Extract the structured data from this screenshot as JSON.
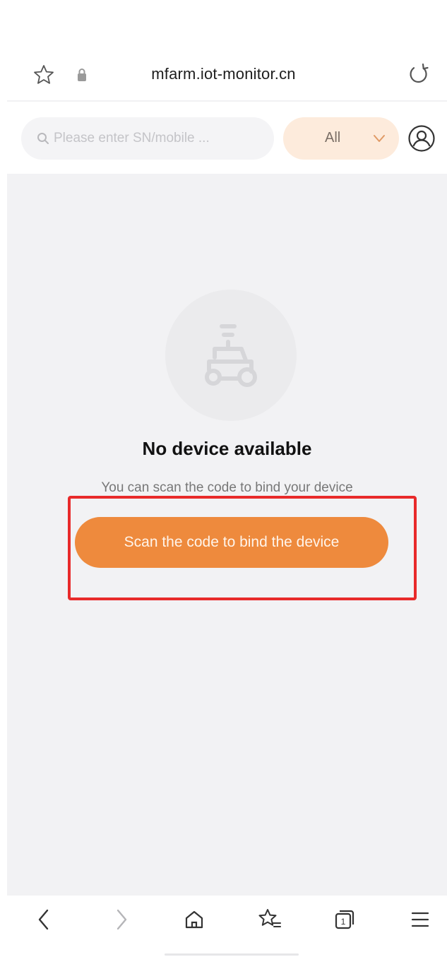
{
  "browser": {
    "url": "mfarm.iot-monitor.cn"
  },
  "search": {
    "placeholder": "Please enter SN/mobile ...",
    "value": ""
  },
  "filter": {
    "selected": "All"
  },
  "empty_state": {
    "title": "No device available",
    "subtitle": "You can scan the code to bind your device",
    "button_label": "Scan the code to bind the device"
  },
  "colors": {
    "accent": "#ee8a3d",
    "filter_bg": "#fdebdc",
    "highlight": "#e82a2a",
    "content_bg": "#f2f2f4"
  },
  "icons": {
    "bookmark": "star-icon",
    "secure": "lock-icon",
    "reload": "reload-icon",
    "search": "search-icon",
    "dropdown": "chevron-down-icon",
    "profile": "user-icon",
    "empty": "tractor-icon",
    "nav": [
      "back-icon",
      "forward-icon",
      "home-icon",
      "bookmarks-icon",
      "tabs-icon",
      "menu-icon"
    ]
  },
  "nav": {
    "tab_count": "1"
  }
}
